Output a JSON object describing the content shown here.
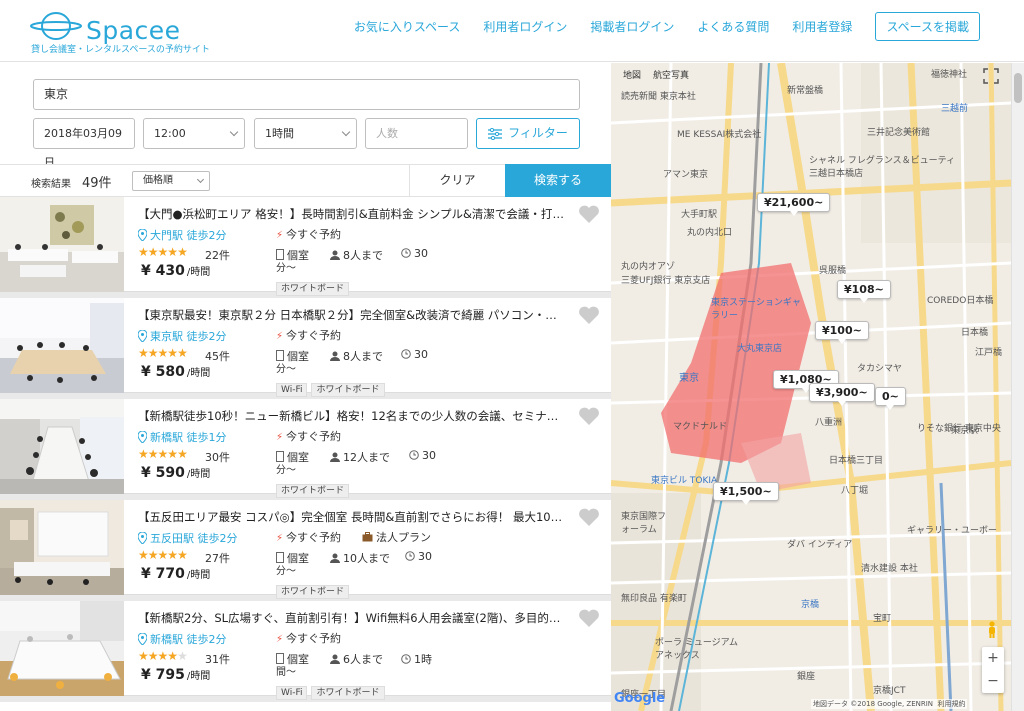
{
  "header": {
    "logo_text": "Spacee",
    "tagline": "貸し会議室・レンタルスペースの予約サイト",
    "nav": [
      "お気に入りスペース",
      "利用者ログイン",
      "掲載者ログイン",
      "よくある質問",
      "利用者登録"
    ],
    "post_button": "スペースを掲載"
  },
  "search": {
    "location": "東京",
    "date": "2018年03月09日",
    "time": "12:00",
    "duration": "1時間",
    "people_placeholder": "人数",
    "filter_label": "フィルター"
  },
  "results": {
    "label": "検索結果",
    "count": "49件",
    "sort": "価格順",
    "clear": "クリア",
    "search_button": "検索する"
  },
  "listings": [
    {
      "title": "【大門●浜松町エリア 格安！】長時間割引&直前料金 シンプル&清潔で会議・打合せ…",
      "station": "大門駅 徒歩2分",
      "stars": "★★★★★",
      "rating": 4.5,
      "reviews": "22件",
      "price": "¥ 430",
      "unit": "/時間",
      "instant": "今すぐ予約",
      "room": "個室",
      "capacity": "8人まで",
      "min_time": "30",
      "min_time_unit": "分～",
      "tags": [
        "ホワイトボード"
      ]
    },
    {
      "title": "【東京駅最安！東京駅２分 日本橋駅２分】完全個室&改装済で綺麗 パソコン・プロジ…",
      "station": "東京駅 徒歩2分",
      "stars": "★★★★★",
      "rating": 4.5,
      "reviews": "45件",
      "price": "¥ 580",
      "unit": "/時間",
      "instant": "今すぐ予約",
      "room": "個室",
      "capacity": "8人まで",
      "min_time": "30",
      "min_time_unit": "分～",
      "tags": [
        "Wi-Fi",
        "ホワイトボード"
      ]
    },
    {
      "title": "【新橋駅徒歩10秒！ニュー新橋ビル】格安！12名までの少人数の会議、セミナーに…",
      "station": "新橋駅 徒歩1分",
      "stars": "★★★★★",
      "rating": 4.5,
      "reviews": "30件",
      "price": "¥ 590",
      "unit": "/時間",
      "instant": "今すぐ予約",
      "room": "個室",
      "capacity": "12人まで",
      "min_time": "30",
      "min_time_unit": "分～",
      "tags": [
        "ホワイトボード"
      ]
    },
    {
      "title": "【五反田エリア最安 コスパ◎】完全個室 長時間&直前割でさらにお得！ 最大10名の…",
      "station": "五反田駅 徒歩2分",
      "stars": "★★★★★",
      "rating": 4.5,
      "reviews": "27件",
      "price": "¥ 770",
      "unit": "/時間",
      "instant": "今すぐ予約",
      "extra": "法人プラン",
      "room": "個室",
      "capacity": "10人まで",
      "min_time": "30",
      "min_time_unit": "分～",
      "tags": [
        "ホワイトボード"
      ]
    },
    {
      "title": "【新橋駅2分、SL広場すぐ、直前割引有！】Wifi無料6人用会議室(2階)、多目的使用…",
      "station": "新橋駅 徒歩2分",
      "stars": "★★★★★",
      "rating": 3.5,
      "reviews": "31件",
      "price": "¥ 795",
      "unit": "/時間",
      "instant": "今すぐ予約",
      "room": "個室",
      "capacity": "6人まで",
      "min_time": "1時",
      "min_time_unit": "間～",
      "tags": [
        "Wi-Fi",
        "ホワイトボード"
      ]
    }
  ],
  "map": {
    "type_map": "地図",
    "type_satellite": "航空写真",
    "pins": [
      "¥21,600~",
      "¥108~",
      "¥100~",
      "¥1,080~",
      "¥3,900~",
      "0~",
      "¥1,500~"
    ],
    "labels": [
      "読売新聞 東京本社",
      "新常盤橋",
      "福徳神社",
      "三越前",
      "三井記念美術館",
      "ME KESSAI株式会社",
      "アマン東京",
      "シャネル フレグランス＆ビューティ 三越日本橋店",
      "大手町駅",
      "丸の内オアゾ",
      "丸の内北口",
      "三菱UFJ銀行 東京支店",
      "東京ステーションギャラリー",
      "大丸東京店",
      "COREDO日本橋",
      "日本橋",
      "タカシマヤ",
      "東京",
      "八重洲",
      "りそな銀行 東京中央",
      "マクドナルド",
      "東京ビル TOKIA",
      "東京国際フォーラム",
      "ダバ インディア",
      "ギャラリー・ユーボー",
      "清水建設 本社",
      "無印良品 有楽町",
      "京橋",
      "宝町",
      "ポーラ ミュージアム アネックス",
      "銀座一丁目",
      "京橋JCT",
      "銀座",
      "呉服橋",
      "日本橋三丁目",
      "八丁堀",
      "東京駅",
      "江戸橋"
    ],
    "attribution": "地図データ ©2018 Google, ZENRIN",
    "terms": "利用規約",
    "google": "Google"
  },
  "colors": {
    "brand": "#2aa7d9",
    "star": "#f5a623",
    "station_highlight": "#f26d6d"
  }
}
